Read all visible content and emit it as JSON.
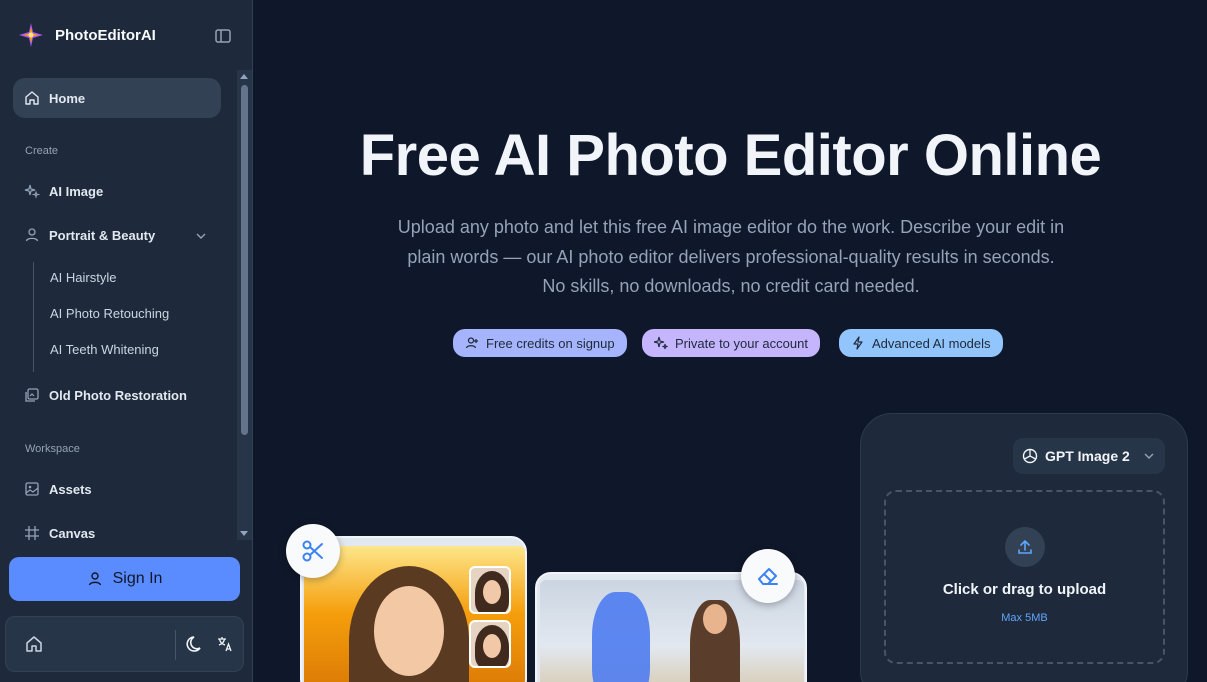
{
  "app": {
    "name": "PhotoEditorAI"
  },
  "sidebar": {
    "home": "Home",
    "create_label": "Create",
    "ai_image": "AI Image",
    "portrait": "Portrait & Beauty",
    "sub_items": [
      "AI Hairstyle",
      "AI Photo Retouching",
      "AI Teeth Whitening"
    ],
    "old_photo": "Old Photo Restoration",
    "workspace_label": "Workspace",
    "assets": "Assets",
    "canvas": "Canvas",
    "sign_in": "Sign In"
  },
  "hero": {
    "title": "Free AI Photo Editor Online",
    "subtitle": "Upload any photo and let this free AI image editor do the work. Describe your edit in plain words — our AI photo editor delivers professional-quality results in seconds. No skills, no downloads, no credit card needed.",
    "pills": [
      "Free credits on signup",
      "Private to your account",
      "Advanced AI models"
    ]
  },
  "upload": {
    "model": "GPT Image 2",
    "title": "Click or drag to upload",
    "hint": "Max 5MB"
  }
}
